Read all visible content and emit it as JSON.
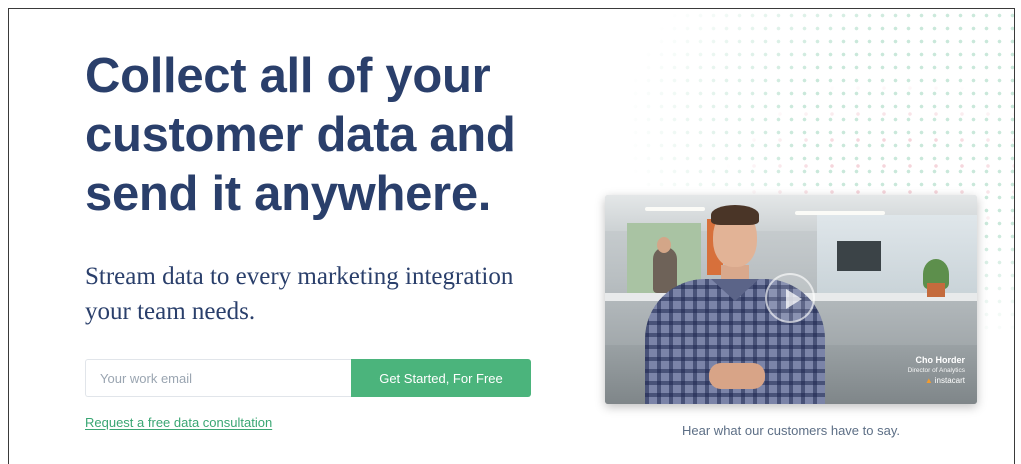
{
  "hero": {
    "headline": "Collect all of your customer data and send it anywhere.",
    "subhead": "Stream data to every marketing integration your team needs."
  },
  "signup": {
    "email_placeholder": "Your work email",
    "cta_label": "Get Started, For Free"
  },
  "consult_link": "Request a free data consultation",
  "video": {
    "person_name": "Cho Horder",
    "person_role": "Director of Analytics",
    "brand": "instacart",
    "caption": "Hear what our customers have to say."
  },
  "colors": {
    "headline": "#2a3f6b",
    "accent_green": "#4bb47c",
    "link_green": "#3aa673",
    "caption_text": "#5d6f86"
  }
}
